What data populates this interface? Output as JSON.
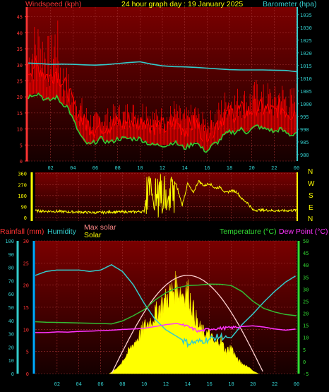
{
  "header": {
    "left_label": "Windspeed (kph)",
    "title": "24 hour graph day : 19 January 2025",
    "right_label": "Barometer (hpa)"
  },
  "bottom_labels": {
    "rainfall": "Rainfall (mm)",
    "humidity": "Humidity",
    "max_solar": "Max solar",
    "solar": "Solar",
    "temperature": "Temperature (°C)",
    "dew_point": "Dew Point (°C)"
  },
  "compass": [
    "N",
    "W",
    "S",
    "E",
    "N"
  ],
  "colors": {
    "panel_bg_top": "#7a0000",
    "panel_bg_bottom": "#150000",
    "wind": "#ff0000",
    "gust": "#ff0000",
    "avg_wind": "#33cc33",
    "barometer": "#33cccc",
    "direction": "#ffff00",
    "rainfall": "#00aaff",
    "humidity": "#33cccc",
    "temperature": "#33bb33",
    "dew_point": "#ff33ff",
    "solar": "#ffff00",
    "max_solar": "#ffd0d0"
  },
  "chart_data": [
    {
      "type": "line",
      "name": "wind",
      "x_ticks": [
        "02",
        "04",
        "06",
        "08",
        "10",
        "12",
        "14",
        "16",
        "18",
        "20",
        "22",
        "00"
      ],
      "left_axis": {
        "label": "Windspeed (kph)",
        "ticks": [
          0,
          5,
          10,
          15,
          20,
          25,
          30,
          35,
          40,
          45
        ],
        "range": [
          0,
          48
        ]
      },
      "right_axis": {
        "label": "Barometer (hpa)",
        "ticks": [
          980,
          985,
          990,
          995,
          1000,
          1005,
          1010,
          1015,
          1020,
          1025,
          1030,
          1035
        ],
        "range": [
          977.5,
          1038
        ]
      },
      "series": [
        {
          "key": "gust",
          "axis": "left",
          "x": [
            0,
            0.5,
            1,
            1.5,
            2,
            2.5,
            3,
            3.5,
            4,
            4.5,
            5,
            5.5,
            6,
            6.5,
            7,
            7.5,
            8,
            8.5,
            9,
            9.5,
            10,
            10.5,
            11,
            11.5,
            12,
            12.5,
            13,
            13.5,
            14,
            14.5,
            15,
            15.5,
            16,
            16.5,
            17,
            17.5,
            18,
            18.5,
            19,
            19.5,
            20,
            20.5,
            21,
            21.5,
            22,
            22.5,
            23,
            23.5,
            24
          ],
          "values": [
            36,
            40,
            42,
            38,
            35,
            44,
            30,
            27,
            22,
            20,
            17,
            15,
            14,
            16,
            15,
            16,
            17,
            16,
            18,
            17,
            17,
            19,
            16,
            15,
            16,
            15,
            18,
            16,
            15,
            16,
            17,
            14,
            14,
            15,
            17,
            20,
            22,
            21,
            22,
            21,
            22,
            24,
            22,
            23,
            21,
            24,
            22,
            21,
            23
          ]
        },
        {
          "key": "wind",
          "axis": "left",
          "x": [
            0,
            0.5,
            1,
            1.5,
            2,
            2.5,
            3,
            3.5,
            4,
            4.5,
            5,
            5.5,
            6,
            6.5,
            7,
            7.5,
            8,
            8.5,
            9,
            9.5,
            10,
            10.5,
            11,
            11.5,
            12,
            12.5,
            13,
            13.5,
            14,
            14.5,
            15,
            15.5,
            16,
            16.5,
            17,
            17.5,
            18,
            18.5,
            19,
            19.5,
            20,
            20.5,
            21,
            21.5,
            22,
            22.5,
            23,
            23.5,
            24
          ],
          "values": [
            28,
            30,
            29,
            27,
            26,
            28,
            25,
            22,
            18,
            14,
            12,
            11,
            10,
            11,
            11,
            11,
            12,
            11,
            13,
            12,
            12,
            13,
            11,
            11,
            11,
            10,
            12,
            11,
            10,
            11,
            12,
            9,
            9,
            10,
            12,
            14,
            15,
            15,
            16,
            15,
            16,
            17,
            16,
            16,
            15,
            17,
            16,
            15,
            16
          ]
        },
        {
          "key": "avg_wind",
          "axis": "left",
          "x": [
            0,
            0.5,
            1,
            1.5,
            2,
            2.5,
            3,
            3.5,
            4,
            4.5,
            5,
            5.5,
            6,
            6.5,
            7,
            7.5,
            8,
            8.5,
            9,
            9.5,
            10,
            10.5,
            11,
            11.5,
            12,
            12.5,
            13,
            13.5,
            14,
            14.5,
            15,
            15.5,
            16,
            16.5,
            17,
            17.5,
            18,
            18.5,
            19,
            19.5,
            20,
            20.5,
            21,
            21.5,
            22,
            22.5,
            23,
            23.5,
            24
          ],
          "values": [
            20,
            21,
            21,
            19,
            19,
            20,
            18,
            17,
            13,
            9,
            6,
            5,
            6,
            7,
            6,
            6,
            7,
            7,
            7,
            7,
            7,
            6,
            5,
            5,
            5,
            5,
            6,
            5,
            4,
            5,
            6,
            4,
            3,
            5,
            6,
            8,
            9,
            9,
            10,
            9,
            10,
            11,
            10,
            10,
            9,
            10,
            9,
            8,
            9
          ]
        },
        {
          "key": "barometer",
          "axis": "right",
          "x": [
            0,
            1,
            2,
            3,
            4,
            5,
            6,
            7,
            8,
            9,
            10,
            11,
            12,
            13,
            14,
            15,
            16,
            17,
            18,
            19,
            20,
            21,
            22,
            23,
            24
          ],
          "values": [
            1016,
            1015.8,
            1015.5,
            1015.6,
            1015.5,
            1015.3,
            1015.2,
            1015.4,
            1015.8,
            1016.2,
            1016.5,
            1015.6,
            1014.9,
            1014.6,
            1014.5,
            1014.3,
            1014.0,
            1013.7,
            1013.4,
            1013.3,
            1013.3,
            1013.3,
            1013.2,
            1013.1,
            1012.6
          ]
        }
      ]
    },
    {
      "type": "line",
      "name": "wind_direction",
      "x_ticks": [],
      "left_axis": {
        "ticks": [
          0,
          90,
          180,
          270,
          360
        ],
        "range": [
          -30,
          370
        ]
      },
      "series": [
        {
          "key": "direction",
          "x": [
            0,
            1,
            2,
            3,
            4,
            5,
            6,
            7,
            8,
            9,
            10,
            10.5,
            11,
            11.5,
            12,
            12.5,
            13,
            13.5,
            14,
            14.5,
            15,
            15.5,
            16,
            16.5,
            17,
            17.5,
            18,
            18.5,
            19,
            19.5,
            20,
            21,
            22,
            23,
            24
          ],
          "values": [
            55,
            50,
            50,
            45,
            45,
            40,
            40,
            45,
            45,
            45,
            50,
            360,
            20,
            360,
            30,
            340,
            250,
            100,
            280,
            200,
            300,
            260,
            280,
            240,
            250,
            200,
            220,
            210,
            150,
            120,
            60,
            60,
            55,
            55,
            60
          ]
        }
      ]
    },
    {
      "type": "line",
      "name": "temperature_humidity_solar",
      "x_ticks": [
        "02",
        "04",
        "06",
        "08",
        "10",
        "12",
        "14",
        "16",
        "18",
        "20",
        "22",
        "00"
      ],
      "left_axis": {
        "label": "Rainfall (mm)",
        "ticks": [
          0,
          5,
          10,
          15,
          20,
          25,
          30
        ],
        "range": [
          0,
          30
        ]
      },
      "left_axis_2": {
        "label": "Humidity",
        "ticks": [
          0,
          10,
          20,
          30,
          40,
          50,
          60,
          70,
          80,
          90,
          100
        ],
        "range": [
          0,
          100
        ]
      },
      "right_axis": {
        "label": "Temperature (°C)",
        "ticks": [
          -5,
          0,
          5,
          10,
          15,
          20,
          25,
          30,
          35,
          40,
          45,
          50
        ],
        "range": [
          -5,
          50
        ]
      },
      "series": [
        {
          "key": "humidity",
          "axis": "left_2",
          "x": [
            0,
            1,
            2,
            3,
            4,
            5,
            6,
            7,
            8,
            9,
            10,
            11,
            12,
            13,
            14,
            15,
            16,
            17,
            18,
            19,
            20,
            21,
            22,
            23,
            24
          ],
          "values": [
            74,
            77,
            78,
            78,
            78,
            77,
            78,
            82,
            77,
            67,
            53,
            41,
            33,
            28,
            23,
            24,
            26,
            28,
            27,
            37,
            45,
            54,
            62,
            69,
            74
          ]
        },
        {
          "key": "temperature",
          "axis": "right",
          "x": [
            0,
            1,
            2,
            3,
            4,
            5,
            6,
            7,
            8,
            9,
            10,
            11,
            12,
            13,
            14,
            15,
            16,
            17,
            18,
            19,
            20,
            21,
            22,
            23,
            24
          ],
          "values": [
            16.5,
            16.3,
            16.2,
            16.1,
            16.0,
            15.9,
            15.8,
            15.6,
            16.8,
            19.0,
            21.5,
            25.5,
            28.5,
            30.5,
            31.5,
            31.7,
            32.1,
            32.0,
            31.5,
            29.0,
            25.0,
            22.0,
            20.5,
            19.5,
            19.0
          ]
        },
        {
          "key": "dew_point",
          "axis": "right",
          "x": [
            0,
            1,
            2,
            3,
            4,
            5,
            6,
            7,
            8,
            9,
            10,
            11,
            12,
            13,
            14,
            15,
            16,
            17,
            18,
            19,
            20,
            21,
            22,
            23,
            24
          ],
          "values": [
            12.0,
            12.0,
            12.3,
            12.2,
            12.5,
            12.6,
            12.8,
            13.0,
            13.3,
            13.5,
            13.8,
            14.5,
            15.3,
            15.8,
            14.5,
            12.5,
            13.5,
            13.8,
            14.0,
            14.5,
            14.8,
            14.3,
            13.5,
            13.0,
            13.5
          ]
        },
        {
          "key": "max_solar",
          "axis": "left_2",
          "x": [
            7,
            8,
            9,
            10,
            11,
            12,
            13,
            14,
            15,
            16,
            17,
            18,
            19,
            20,
            21
          ],
          "values": [
            0,
            9,
            27,
            44,
            59,
            69,
            74,
            74,
            69,
            59,
            44,
            27,
            9,
            2,
            0
          ]
        },
        {
          "key": "solar",
          "axis": "left_2",
          "type": "area",
          "x": [
            6.8,
            7.5,
            8,
            9,
            9.5,
            10,
            10.5,
            11,
            11.5,
            12,
            12.5,
            13,
            13.5,
            14,
            14.5,
            15,
            15.5,
            16,
            16.5,
            17,
            17.5,
            18,
            18.5,
            19,
            19.5,
            20,
            20.5
          ],
          "values": [
            0,
            4,
            10,
            24,
            30,
            38,
            42,
            48,
            55,
            60,
            66,
            72,
            65,
            68,
            52,
            38,
            33,
            32,
            24,
            28,
            18,
            22,
            12,
            8,
            6,
            2,
            0
          ]
        }
      ]
    }
  ]
}
